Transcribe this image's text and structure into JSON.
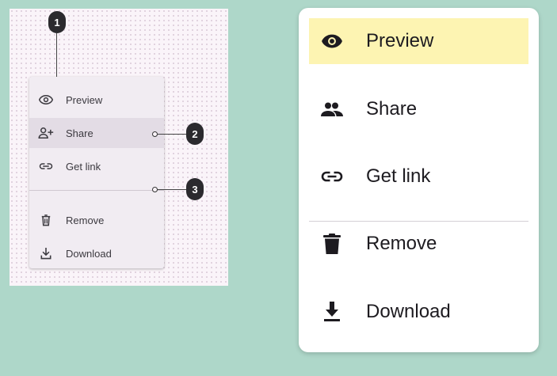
{
  "spec": {
    "menu_items": [
      {
        "label": "Preview",
        "icon": "eye-icon"
      },
      {
        "label": "Share",
        "icon": "person-add-icon"
      },
      {
        "label": "Get link",
        "icon": "link-icon"
      },
      {
        "label": "Remove",
        "icon": "trash-icon"
      },
      {
        "label": "Download",
        "icon": "download-icon"
      }
    ],
    "callouts": [
      "1",
      "2",
      "3"
    ]
  },
  "menu": {
    "items": [
      {
        "label": "Preview",
        "icon": "eye-icon",
        "state": "active"
      },
      {
        "label": "Share",
        "icon": "people-icon"
      },
      {
        "label": "Get link",
        "icon": "link-icon"
      },
      {
        "label": "Remove",
        "icon": "trash-icon"
      },
      {
        "label": "Download",
        "icon": "download-icon"
      }
    ]
  },
  "colors": {
    "background": "#aed7c9",
    "active_item": "#fdf4b2",
    "spec_highlight": "#e3dce5"
  }
}
